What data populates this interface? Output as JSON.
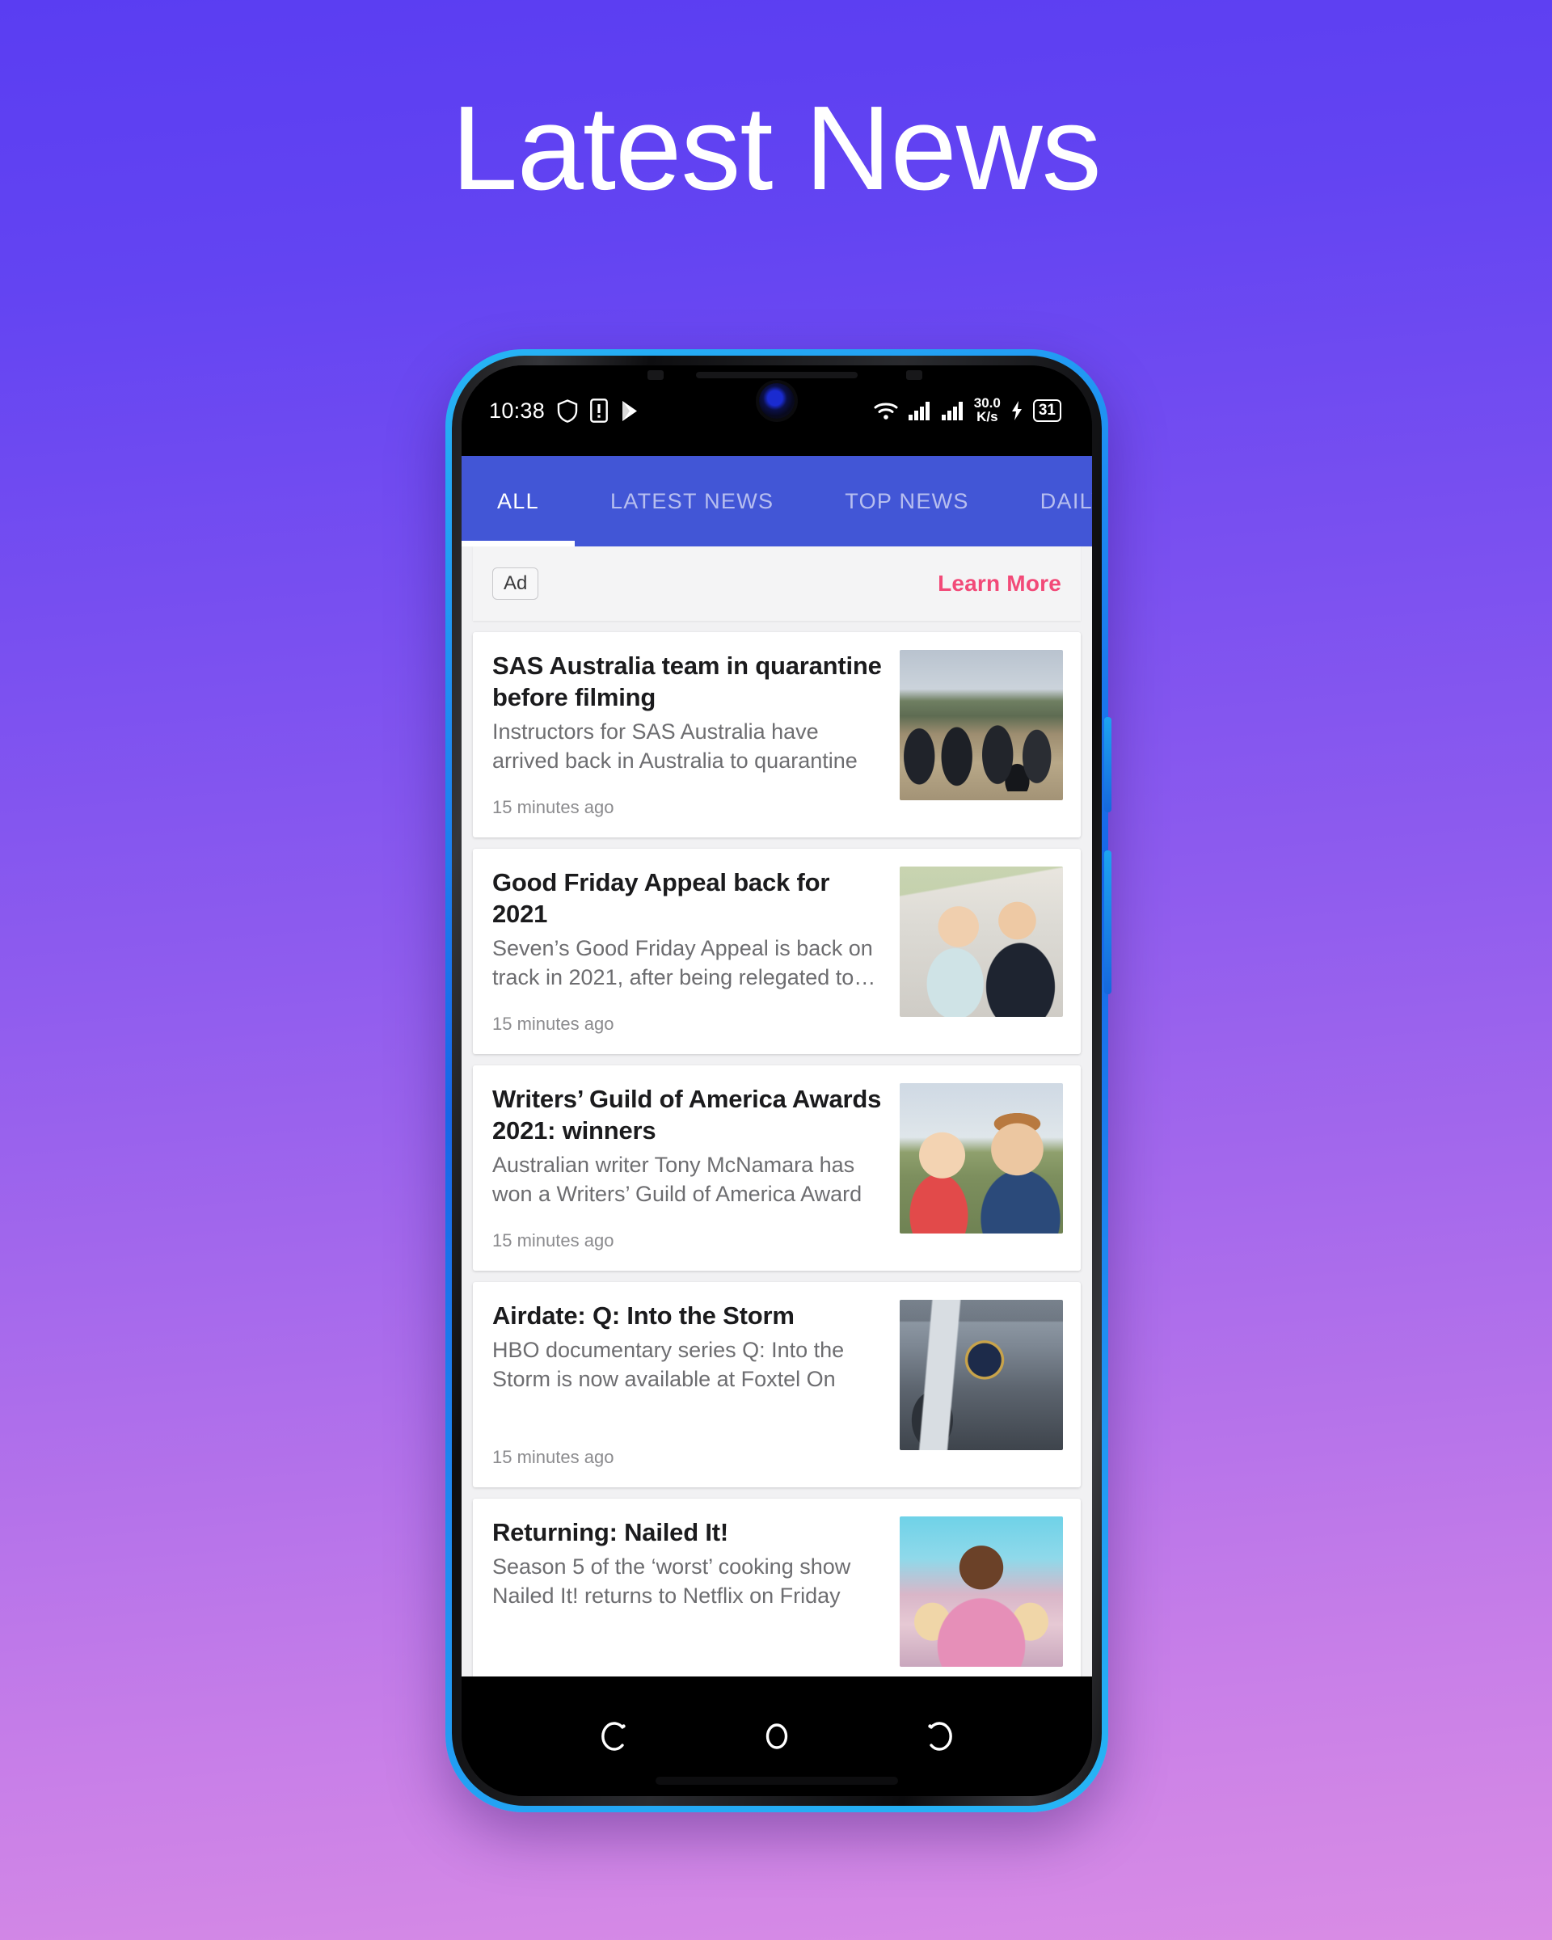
{
  "page": {
    "title": "Latest News",
    "background_top": "#5a3df2",
    "background_bottom": "#d98ce5"
  },
  "phone": {
    "edge_color": "#1f8ef2",
    "frame_color": "#1a1a1c"
  },
  "status_bar": {
    "time": "10:38",
    "icons_left": [
      "shield-icon",
      "sim-card-icon",
      "play-store-icon"
    ],
    "icons_right": [
      "wifi-icon",
      "signal-1-icon",
      "signal-2-icon"
    ],
    "net_speed_value": "30.0",
    "net_speed_unit": "K/s",
    "charging_icon": "charging-bolt-icon",
    "battery_level": "31"
  },
  "app": {
    "accent_color": "#4256d6",
    "tabs": [
      {
        "label": "ALL",
        "active": true
      },
      {
        "label": "LATEST NEWS",
        "active": false
      },
      {
        "label": "TOP NEWS",
        "active": false
      },
      {
        "label": "DAILYTELEGRAPH",
        "active": false
      }
    ],
    "ad": {
      "badge": "Ad",
      "cta": "Learn More",
      "cta_color": "#f24a78"
    },
    "articles": [
      {
        "title": "SAS Australia team in quarantine before filming",
        "description": "Instructors for SAS Australia have arrived back in Australia to quarantine ahead of …",
        "time": "15 minutes ago",
        "thumb": "sas-australia-team-photo"
      },
      {
        "title": "Good Friday Appeal back for 2021",
        "description": "Seven’s Good Friday Appeal is back on track in 2021, after being relegated to…",
        "time": "15 minutes ago",
        "thumb": "good-friday-appeal-photo"
      },
      {
        "title": "Writers’ Guild of America Awards 2021: winners",
        "description": "Australian writer Tony McNamara has won a Writers’ Guild of America Award f…",
        "time": "15 minutes ago",
        "thumb": "ted-lasso-photo"
      },
      {
        "title": "Airdate: Q: Into the Storm",
        "description": "HBO documentary series Q: Into the Storm is now available at Foxtel On Dem…",
        "time": "15 minutes ago",
        "thumb": "q-into-the-storm-photo"
      },
      {
        "title": "Returning: Nailed It!",
        "description": "Season 5 of the ‘worst’ cooking show Nailed It! returns to Netflix on Friday this…",
        "time": "",
        "thumb": "nailed-it-photo"
      }
    ]
  },
  "nav_bar": {
    "buttons": [
      "recent-apps-icon",
      "home-icon",
      "back-icon"
    ]
  }
}
